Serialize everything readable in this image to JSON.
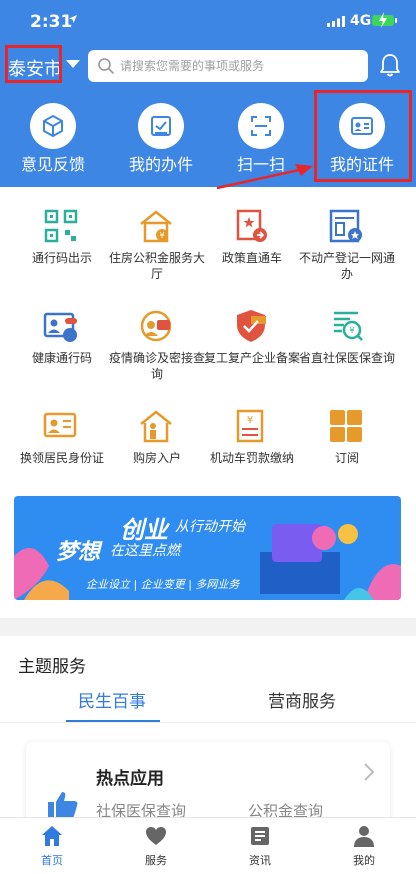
{
  "status_bar": {
    "time": "2:31",
    "network": "4G"
  },
  "header": {
    "city": "泰安市",
    "search_placeholder": "请搜索您需要的事项或服务"
  },
  "quick_actions": [
    {
      "label": "意见反馈",
      "icon": "cube-icon"
    },
    {
      "label": "我的办件",
      "icon": "task-check-icon"
    },
    {
      "label": "扫一扫",
      "icon": "scan-icon"
    },
    {
      "label": "我的证件",
      "icon": "id-card-icon"
    }
  ],
  "services": [
    {
      "label": "通行码出示",
      "icon": "qr-code-icon"
    },
    {
      "label": "住房公积金服务大厅",
      "icon": "house-fund-icon"
    },
    {
      "label": "政策直通车",
      "icon": "policy-doc-icon"
    },
    {
      "label": "不动产登记一网通办",
      "icon": "property-register-icon"
    },
    {
      "label": "健康通行码",
      "icon": "health-code-icon"
    },
    {
      "label": "疫情确诊及密接查询",
      "icon": "epidemic-query-icon"
    },
    {
      "label": "复工复产企业备案",
      "icon": "resume-work-shield-icon"
    },
    {
      "label": "省直社保医保查询",
      "icon": "insurance-query-icon"
    },
    {
      "label": "换领居民身份证",
      "icon": "id-renew-icon"
    },
    {
      "label": "购房入户",
      "icon": "house-person-icon"
    },
    {
      "label": "机动车罚款缴纳",
      "icon": "vehicle-fine-icon"
    },
    {
      "label": "订阅",
      "icon": "subscribe-icon"
    }
  ],
  "banner": {
    "line1": "创业",
    "line1_small": "从行动开始",
    "line2": "梦想",
    "line2_small": "在这里点燃",
    "tags": "企业设立 | 企业变更 | 多网业务"
  },
  "theme_section": {
    "title": "主题服务",
    "tabs": [
      "民生百事",
      "营商服务"
    ],
    "active_tab": 0
  },
  "hot_card": {
    "title": "热点应用",
    "items": [
      "社保医保查询",
      "公积金查询"
    ]
  },
  "bottom_nav": [
    {
      "label": "首页",
      "icon": "home-icon",
      "active": true
    },
    {
      "label": "服务",
      "icon": "heart-icon",
      "active": false
    },
    {
      "label": "资讯",
      "icon": "news-icon",
      "active": false
    },
    {
      "label": "我的",
      "icon": "profile-icon",
      "active": false
    }
  ],
  "colors": {
    "brand_blue": "#3d86e4",
    "highlight_red": "#e8262a",
    "active_blue": "#2f7be0"
  }
}
